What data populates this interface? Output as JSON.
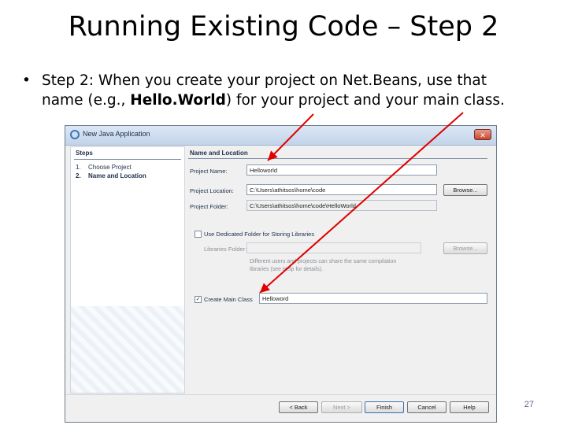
{
  "slide": {
    "title": "Running Existing Code – Step 2",
    "bullet_symbol": "•",
    "bullet_line1": "Step 2: When you create your project on Net.Beans, use that",
    "bullet_line2_pre": "name (e.g., ",
    "bullet_line2_bold": "Hello.World",
    "bullet_line2_post": ") for your project and your main class.",
    "page_number": "27"
  },
  "dialog": {
    "title": "New Java Application",
    "close_glyph": "✕",
    "steps": {
      "heading": "Steps",
      "items": [
        {
          "num": "1.",
          "label": "Choose Project"
        },
        {
          "num": "2.",
          "label": "Name and Location"
        }
      ]
    },
    "section_title": "Name and Location",
    "project_name": {
      "label": "Project Name:",
      "value": "Helloworld"
    },
    "project_location": {
      "label": "Project Location:",
      "value": "C:\\Users\\athitsos\\home\\code",
      "browse_label": "Browse..."
    },
    "project_folder": {
      "label": "Project Folder:",
      "value": "C:\\Users\\athitsos\\home\\code\\HelloWorld"
    },
    "dedicated_folder": {
      "checked": false,
      "label": "Use Dedicated Folder for Storing Libraries"
    },
    "libraries_folder": {
      "label": "Libraries Folder:",
      "value": "",
      "browse_label": "Browse..."
    },
    "shared_note_line1": "Different users and projects can share the same compilation",
    "shared_note_line2": "libraries (see Help for details).",
    "main_class": {
      "checked": true,
      "check_glyph": "✓",
      "label": "Create Main Class",
      "value": "Helloword"
    },
    "buttons": {
      "back": "< Back",
      "next": "Next >",
      "finish": "Finish",
      "cancel": "Cancel",
      "help": "Help"
    }
  },
  "colors": {
    "arrow": "#e00000",
    "titlebar": "#c3d4ea",
    "window_border": "#6f7c8c"
  },
  "icons": [
    "app-icon",
    "close-icon",
    "checkbox-icon"
  ]
}
